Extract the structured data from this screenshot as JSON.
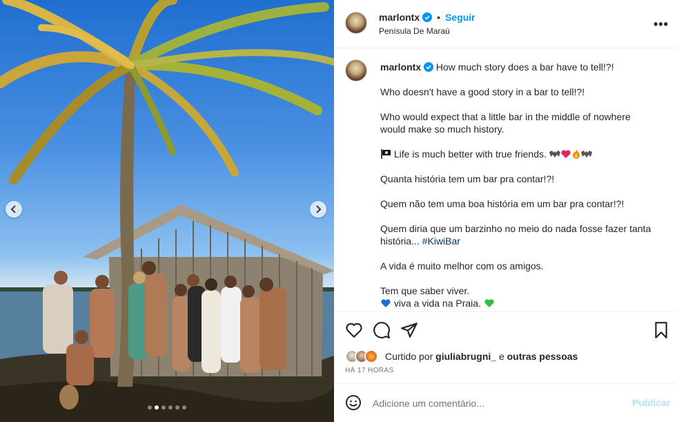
{
  "post": {
    "username": "marlontx",
    "follow_label": "Seguir",
    "separator": "•",
    "location": "Penísula De Maraú",
    "more_label": "•••"
  },
  "caption": {
    "username": "marlontx",
    "first_line": "How much story does a bar have to tell!?!",
    "line_2": "Who doesn't have a good story in a bar to tell!?!",
    "line_3a": "Who would expect that a little bar in the middle of nowhere",
    "line_3b": "would make so much history.",
    "line_4": "Life is much better with true friends.",
    "line_5": "Quanta história tem um bar pra contar!?!",
    "line_6": "Quem não tem uma boa história em um bar pra contar!?!",
    "line_7a": "Quem diria que um barzinho no meio do nada fosse fazer tanta",
    "line_7b": "história...",
    "hashtag": "#KiwiBar",
    "line_8": "A vida é muito melhor com os amigos.",
    "line_9": "Tem que saber viver.",
    "line_10": "viva a vida na Praia."
  },
  "likes": {
    "prefix": "Curtido por",
    "user": "giuliabrugni_",
    "connector": "e",
    "others": "outras pessoas"
  },
  "timestamp": "HÁ 17 HORAS",
  "comment": {
    "placeholder": "Adicione um comentário...",
    "publish_label": "Publicar"
  },
  "carousel": {
    "slide_count": 6,
    "active_index": 1
  },
  "icons": [
    "verified-badge-icon",
    "more-options-icon",
    "heart-icon",
    "comment-icon",
    "share-icon",
    "bookmark-icon",
    "emoji-icon",
    "chevron-left-icon",
    "chevron-right-icon"
  ],
  "colors": {
    "accent": "#0095f6",
    "hashtag": "#00376b",
    "muted": "#737373",
    "publish_disabled": "#b2dffc"
  }
}
